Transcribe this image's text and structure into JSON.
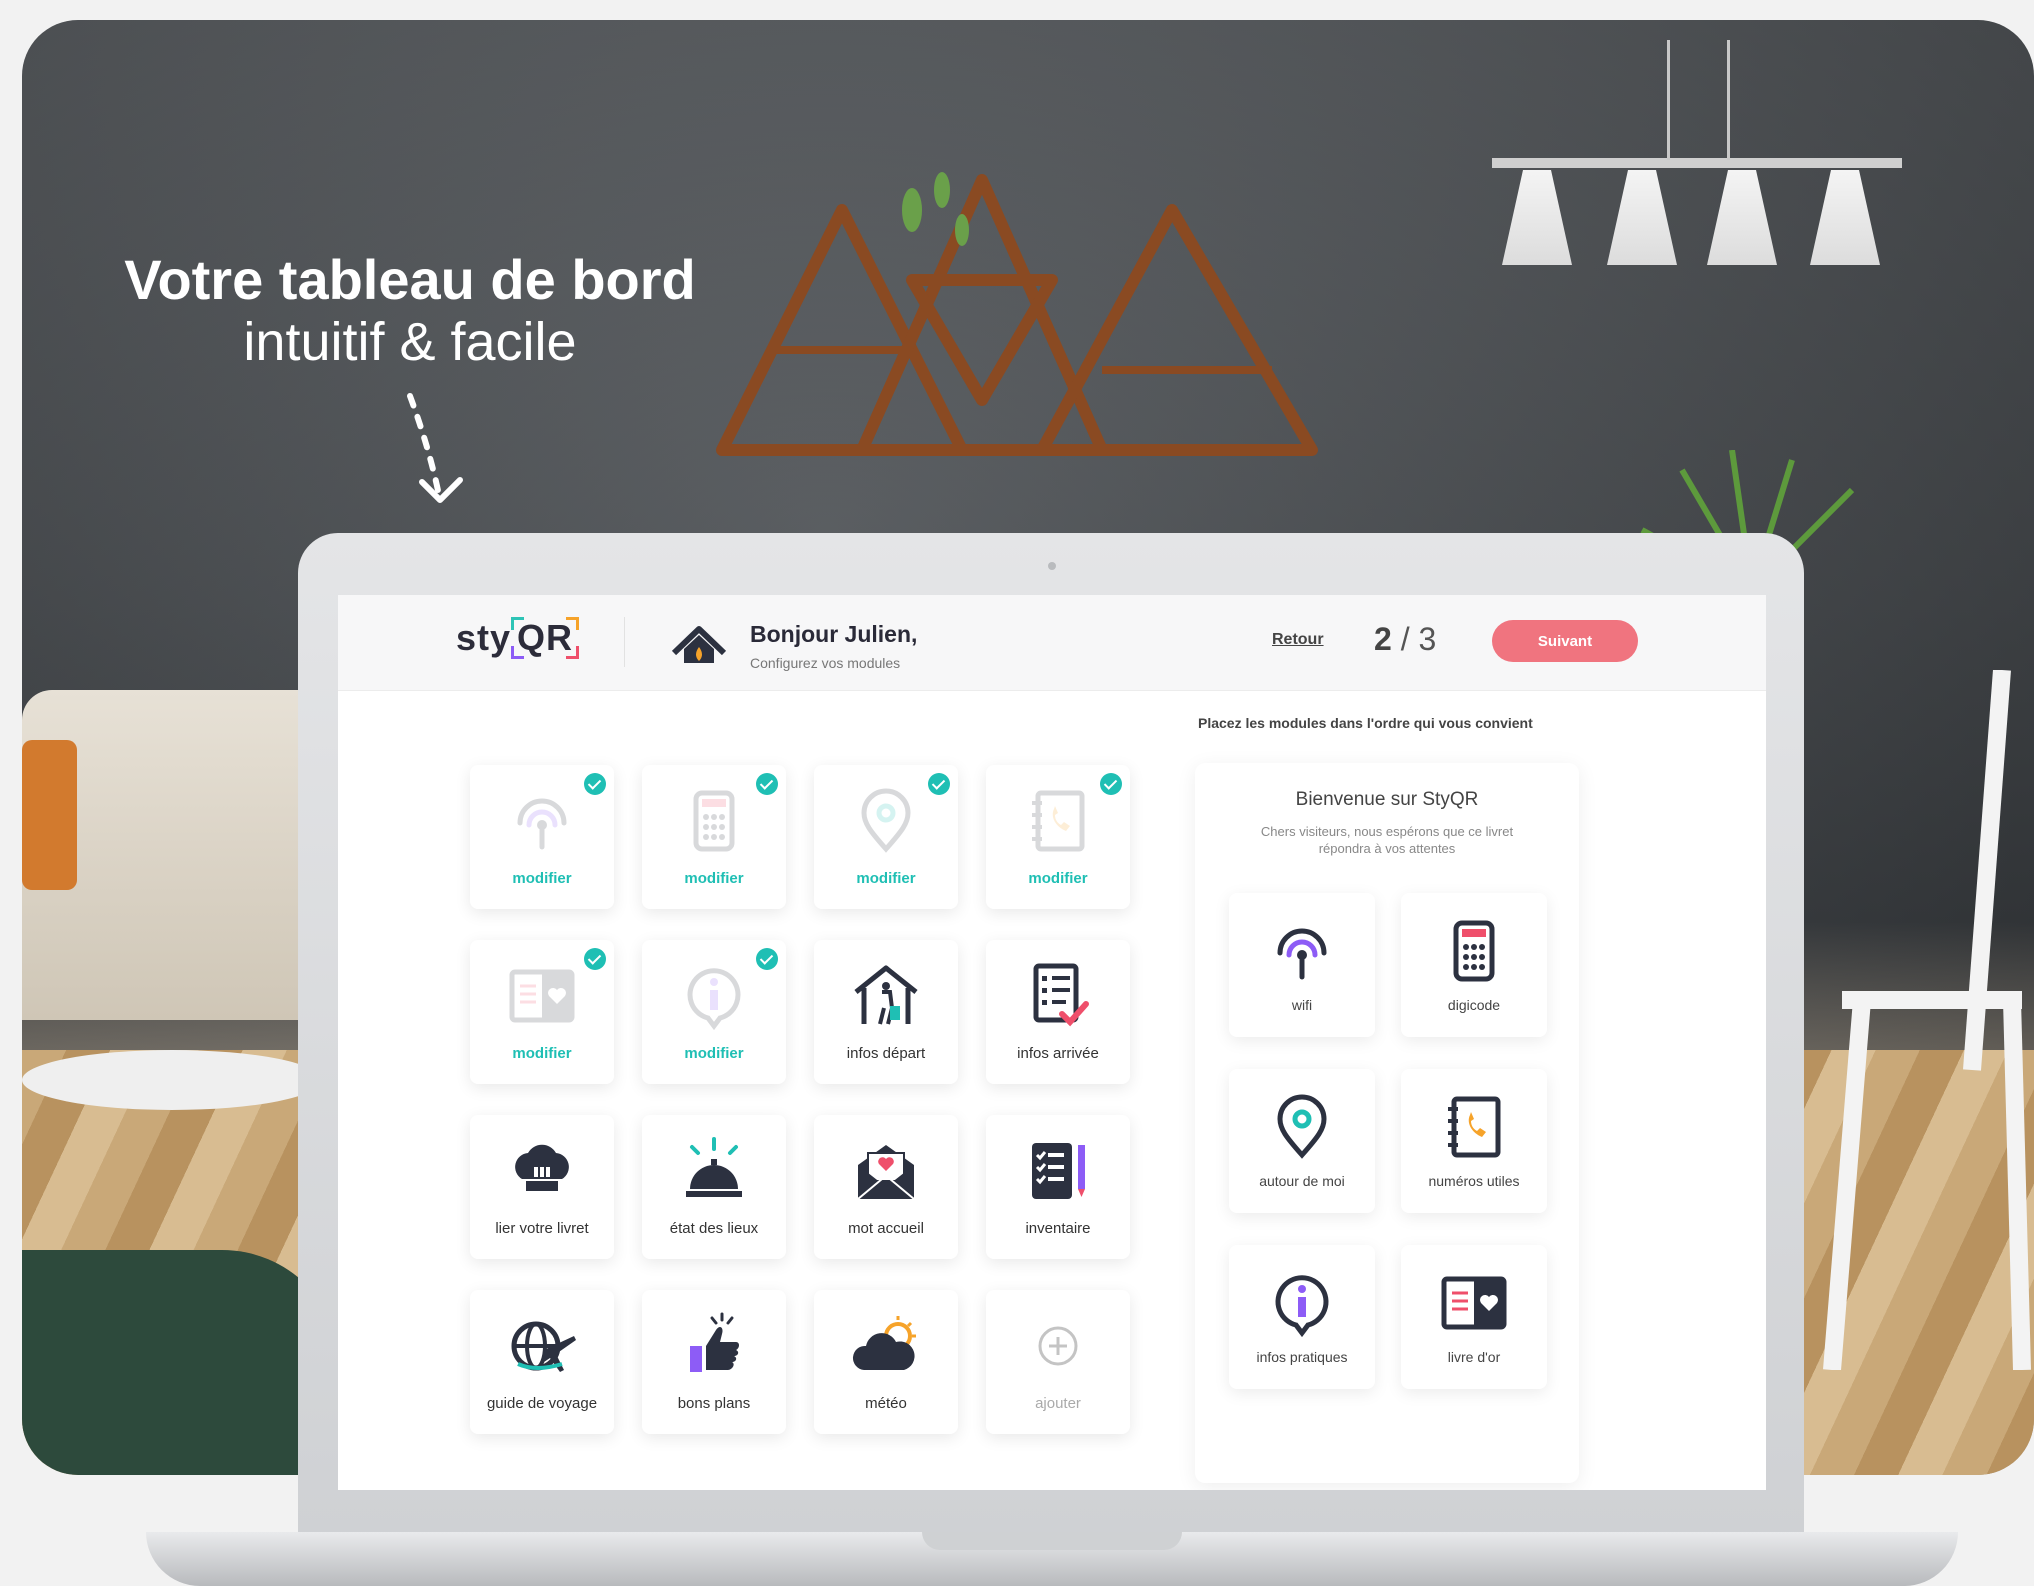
{
  "headline": {
    "title": "Votre tableau de bord",
    "subtitle": "intuitif & facile"
  },
  "app": {
    "logo_left": "sty",
    "logo_right": "QR",
    "greeting": "Bonjour Julien,",
    "greeting_sub": "Configurez vos modules",
    "back_label": "Retour",
    "step_current": "2",
    "step_sep": "/",
    "step_total": "3",
    "next_label": "Suivant"
  },
  "colors": {
    "accent": "#1fbfb4",
    "next_button": "#f0747f",
    "purple": "#8d5cf6",
    "pink": "#ef4f6b"
  },
  "modules": [
    {
      "label": "modifier",
      "icon": "wifi-icon",
      "configured": true
    },
    {
      "label": "modifier",
      "icon": "digicode-icon",
      "configured": true
    },
    {
      "label": "modifier",
      "icon": "location-pin-icon",
      "configured": true
    },
    {
      "label": "modifier",
      "icon": "phone-book-icon",
      "configured": true
    },
    {
      "label": "modifier",
      "icon": "guestbook-icon",
      "configured": true
    },
    {
      "label": "modifier",
      "icon": "info-icon",
      "configured": true
    },
    {
      "label": "infos départ",
      "icon": "departure-house-icon",
      "configured": false
    },
    {
      "label": "infos arrivée",
      "icon": "arrival-checklist-icon",
      "configured": false
    },
    {
      "label": "lier votre livret",
      "icon": "chef-hat-icon",
      "configured": false
    },
    {
      "label": "état des lieux",
      "icon": "reception-bell-icon",
      "configured": false
    },
    {
      "label": "mot accueil",
      "icon": "envelope-heart-icon",
      "configured": false
    },
    {
      "label": "inventaire",
      "icon": "inventory-list-icon",
      "configured": false
    },
    {
      "label": "guide de voyage",
      "icon": "globe-plane-icon",
      "configured": false
    },
    {
      "label": "bons plans",
      "icon": "thumbs-up-icon",
      "configured": false
    },
    {
      "label": "météo",
      "icon": "weather-cloud-icon",
      "configured": false
    },
    {
      "label": "ajouter",
      "icon": "plus-circle-icon",
      "configured": false
    }
  ],
  "preview": {
    "hint": "Placez les modules dans l'ordre qui vous convient",
    "title": "Bienvenue sur StyQR",
    "subtitle": "Chers visiteurs, nous espérons que ce livret répondra à vos attentes",
    "items": [
      {
        "label": "wifi",
        "icon": "wifi-icon"
      },
      {
        "label": "digicode",
        "icon": "digicode-icon"
      },
      {
        "label": "autour de moi",
        "icon": "location-pin-icon"
      },
      {
        "label": "numéros utiles",
        "icon": "phone-book-icon"
      },
      {
        "label": "infos pratiques",
        "icon": "info-icon"
      },
      {
        "label": "livre d'or",
        "icon": "guestbook-icon"
      }
    ]
  }
}
